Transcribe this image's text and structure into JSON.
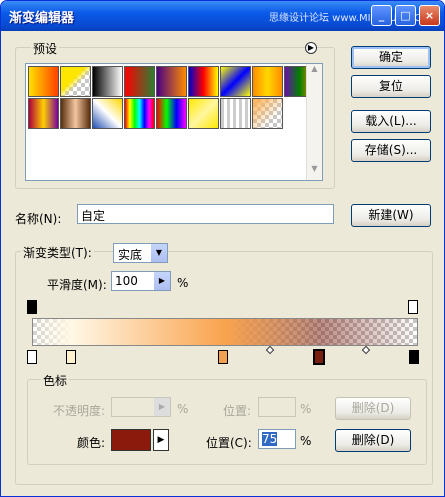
{
  "window": {
    "title": "渐变编辑器",
    "watermark": "思缘设计论坛 www.MISSYUAN.COM"
  },
  "presets": {
    "label": "预设",
    "menu_icon": "circle-arrow-right-icon",
    "swatches": [
      "linear-gradient(90deg,#ffe000,#ff4000)",
      "linear-gradient(135deg,#ffe600 40%,transparent 60%)",
      "linear-gradient(90deg,#000,#fff)",
      "linear-gradient(90deg,#ff0000,#2e7d32)",
      "linear-gradient(90deg,#4b0082,#ff8c00)",
      "linear-gradient(90deg,#0000cc,#ff0000,#ffff00)",
      "linear-gradient(135deg,#ff0,#00f 50%,#ff0)",
      "linear-gradient(90deg,#ff8c00,#ffd700,#ff8c00)",
      "linear-gradient(90deg,#6a0dad,#008000,#ff8c00)",
      "linear-gradient(90deg,#b0003a,#ffd000,#7a0099)",
      "linear-gradient(90deg,#5a2d0c,#f4c7a1,#5a2d0c)",
      "linear-gradient(45deg,#1e50b4,#fff,#ffd700)",
      "linear-gradient(90deg,#f00,#ff0,#0f0,#0ff,#00f,#f0f,#f00)",
      "linear-gradient(90deg,#f00,#0f0,#00f,#f0f)",
      "linear-gradient(135deg,#ffe900,#fff6a0,#ffe900)",
      "repeating-linear-gradient(90deg,#ccc 0 3px,#fff 3px 6px)",
      "linear-gradient(135deg,#ffb050 0%,transparent 70%)"
    ]
  },
  "buttons": {
    "ok": "确定",
    "reset": "复位",
    "load": "载入(L)...",
    "save": "存储(S)...",
    "new": "新建(W)"
  },
  "name": {
    "label": "名称(N):",
    "value": "自定"
  },
  "gradient_type": {
    "label": "渐变类型(T):",
    "value": "实底"
  },
  "smoothness": {
    "label": "平滑度(M):",
    "value": "100",
    "unit": "%"
  },
  "bar": {
    "colors": [
      "#fff8e6",
      "#f9a34d",
      "#7a1f10"
    ]
  },
  "color_stops_group": {
    "label": "色标",
    "opacity_label": "不透明度:",
    "opacity_unit": "%",
    "position_label_1": "位置:",
    "position_unit_1": "%",
    "delete_label_1": "删除(D)",
    "color_label": "颜色:",
    "color_value": "#8b1a0c",
    "position_label_2": "位置(C):",
    "position_value": "75",
    "position_unit_2": "%",
    "delete_label_2": "删除(D)"
  }
}
